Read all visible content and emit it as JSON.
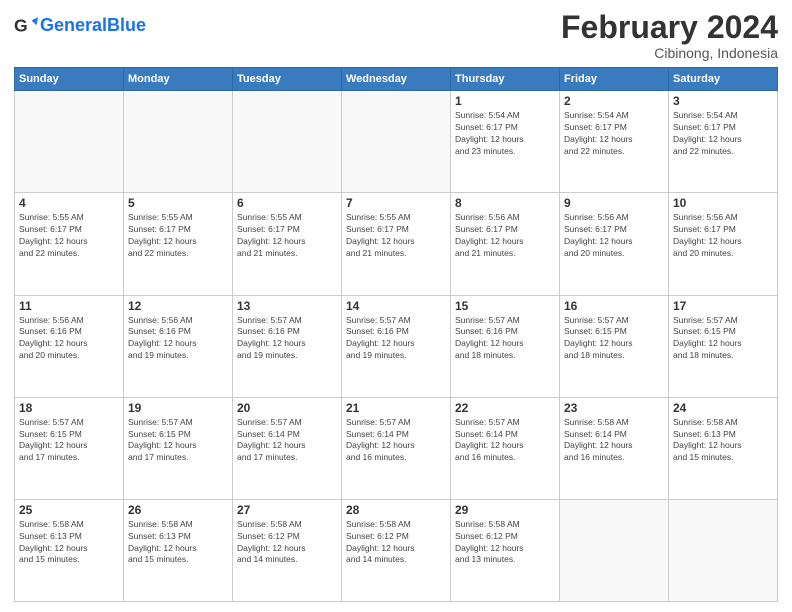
{
  "header": {
    "logo_general": "General",
    "logo_blue": "Blue",
    "title": "February 2024",
    "subtitle": "Cibinong, Indonesia"
  },
  "days_of_week": [
    "Sunday",
    "Monday",
    "Tuesday",
    "Wednesday",
    "Thursday",
    "Friday",
    "Saturday"
  ],
  "weeks": [
    [
      {
        "day": "",
        "info": ""
      },
      {
        "day": "",
        "info": ""
      },
      {
        "day": "",
        "info": ""
      },
      {
        "day": "",
        "info": ""
      },
      {
        "day": "1",
        "info": "Sunrise: 5:54 AM\nSunset: 6:17 PM\nDaylight: 12 hours\nand 23 minutes."
      },
      {
        "day": "2",
        "info": "Sunrise: 5:54 AM\nSunset: 6:17 PM\nDaylight: 12 hours\nand 22 minutes."
      },
      {
        "day": "3",
        "info": "Sunrise: 5:54 AM\nSunset: 6:17 PM\nDaylight: 12 hours\nand 22 minutes."
      }
    ],
    [
      {
        "day": "4",
        "info": "Sunrise: 5:55 AM\nSunset: 6:17 PM\nDaylight: 12 hours\nand 22 minutes."
      },
      {
        "day": "5",
        "info": "Sunrise: 5:55 AM\nSunset: 6:17 PM\nDaylight: 12 hours\nand 22 minutes."
      },
      {
        "day": "6",
        "info": "Sunrise: 5:55 AM\nSunset: 6:17 PM\nDaylight: 12 hours\nand 21 minutes."
      },
      {
        "day": "7",
        "info": "Sunrise: 5:55 AM\nSunset: 6:17 PM\nDaylight: 12 hours\nand 21 minutes."
      },
      {
        "day": "8",
        "info": "Sunrise: 5:56 AM\nSunset: 6:17 PM\nDaylight: 12 hours\nand 21 minutes."
      },
      {
        "day": "9",
        "info": "Sunrise: 5:56 AM\nSunset: 6:17 PM\nDaylight: 12 hours\nand 20 minutes."
      },
      {
        "day": "10",
        "info": "Sunrise: 5:56 AM\nSunset: 6:17 PM\nDaylight: 12 hours\nand 20 minutes."
      }
    ],
    [
      {
        "day": "11",
        "info": "Sunrise: 5:56 AM\nSunset: 6:16 PM\nDaylight: 12 hours\nand 20 minutes."
      },
      {
        "day": "12",
        "info": "Sunrise: 5:56 AM\nSunset: 6:16 PM\nDaylight: 12 hours\nand 19 minutes."
      },
      {
        "day": "13",
        "info": "Sunrise: 5:57 AM\nSunset: 6:16 PM\nDaylight: 12 hours\nand 19 minutes."
      },
      {
        "day": "14",
        "info": "Sunrise: 5:57 AM\nSunset: 6:16 PM\nDaylight: 12 hours\nand 19 minutes."
      },
      {
        "day": "15",
        "info": "Sunrise: 5:57 AM\nSunset: 6:16 PM\nDaylight: 12 hours\nand 18 minutes."
      },
      {
        "day": "16",
        "info": "Sunrise: 5:57 AM\nSunset: 6:15 PM\nDaylight: 12 hours\nand 18 minutes."
      },
      {
        "day": "17",
        "info": "Sunrise: 5:57 AM\nSunset: 6:15 PM\nDaylight: 12 hours\nand 18 minutes."
      }
    ],
    [
      {
        "day": "18",
        "info": "Sunrise: 5:57 AM\nSunset: 6:15 PM\nDaylight: 12 hours\nand 17 minutes."
      },
      {
        "day": "19",
        "info": "Sunrise: 5:57 AM\nSunset: 6:15 PM\nDaylight: 12 hours\nand 17 minutes."
      },
      {
        "day": "20",
        "info": "Sunrise: 5:57 AM\nSunset: 6:14 PM\nDaylight: 12 hours\nand 17 minutes."
      },
      {
        "day": "21",
        "info": "Sunrise: 5:57 AM\nSunset: 6:14 PM\nDaylight: 12 hours\nand 16 minutes."
      },
      {
        "day": "22",
        "info": "Sunrise: 5:57 AM\nSunset: 6:14 PM\nDaylight: 12 hours\nand 16 minutes."
      },
      {
        "day": "23",
        "info": "Sunrise: 5:58 AM\nSunset: 6:14 PM\nDaylight: 12 hours\nand 16 minutes."
      },
      {
        "day": "24",
        "info": "Sunrise: 5:58 AM\nSunset: 6:13 PM\nDaylight: 12 hours\nand 15 minutes."
      }
    ],
    [
      {
        "day": "25",
        "info": "Sunrise: 5:58 AM\nSunset: 6:13 PM\nDaylight: 12 hours\nand 15 minutes."
      },
      {
        "day": "26",
        "info": "Sunrise: 5:58 AM\nSunset: 6:13 PM\nDaylight: 12 hours\nand 15 minutes."
      },
      {
        "day": "27",
        "info": "Sunrise: 5:58 AM\nSunset: 6:12 PM\nDaylight: 12 hours\nand 14 minutes."
      },
      {
        "day": "28",
        "info": "Sunrise: 5:58 AM\nSunset: 6:12 PM\nDaylight: 12 hours\nand 14 minutes."
      },
      {
        "day": "29",
        "info": "Sunrise: 5:58 AM\nSunset: 6:12 PM\nDaylight: 12 hours\nand 13 minutes."
      },
      {
        "day": "",
        "info": ""
      },
      {
        "day": "",
        "info": ""
      }
    ]
  ]
}
